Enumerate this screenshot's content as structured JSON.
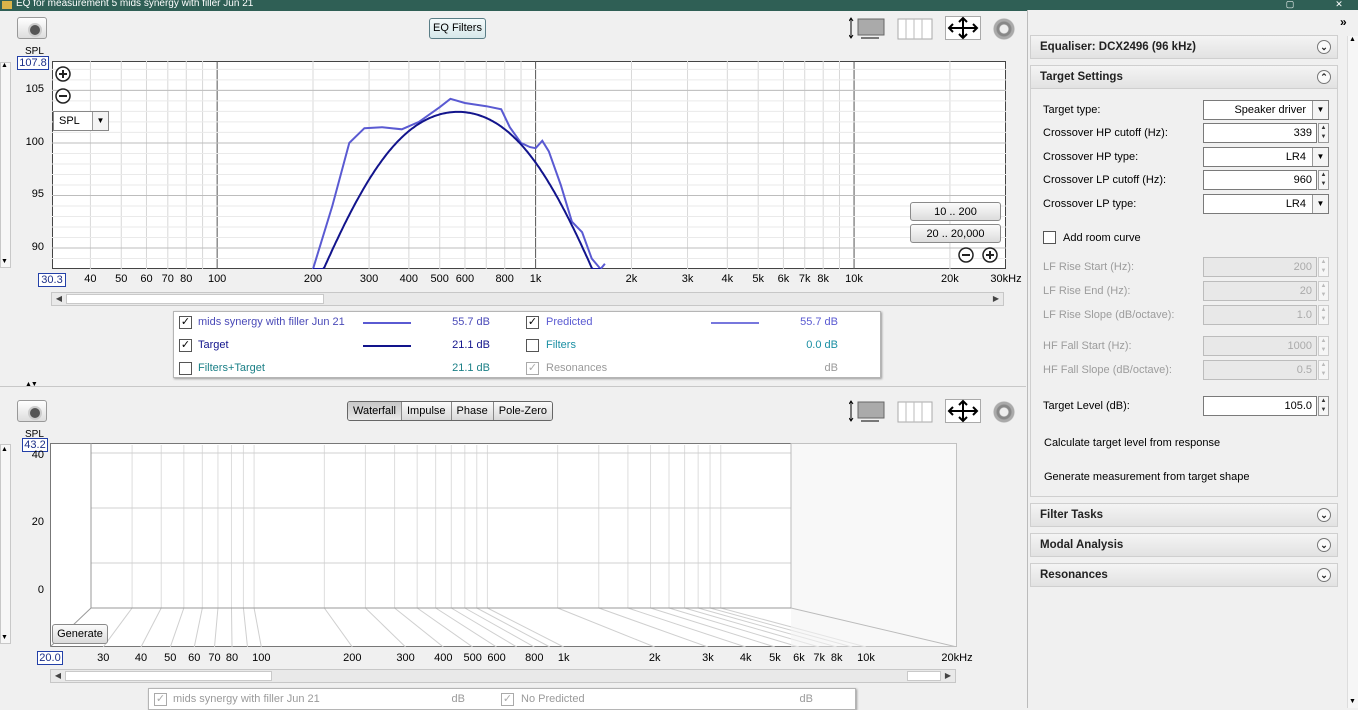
{
  "window": {
    "title": "EQ for measurement 5 mids synergy with filler Jun 21"
  },
  "top_panel": {
    "eq_filters_button": "EQ Filters",
    "y_axis_title": "SPL",
    "y_top_value": "107.8",
    "x_left_value": "30.3",
    "y_ticks": [
      "105",
      "100",
      "95",
      "90"
    ],
    "x_ticks": [
      "40",
      "50",
      "60",
      "70",
      "80",
      "100",
      "200",
      "300",
      "400",
      "500",
      "600",
      "800",
      "1k",
      "2k",
      "3k",
      "4k",
      "5k",
      "6k",
      "7k",
      "8k",
      "10k",
      "20k",
      "30kHz"
    ],
    "spl_select": "SPL",
    "range_buttons": [
      "10 .. 200",
      "20 .. 20,000"
    ],
    "legend": [
      {
        "label": "mids synergy with filler Jun 21",
        "value": "55.7 dB",
        "checked": true
      },
      {
        "label": "Predicted",
        "value": "55.7 dB",
        "checked": true
      },
      {
        "label": "Target",
        "value": "21.1 dB",
        "checked": true
      },
      {
        "label": "Filters",
        "value": "0.0 dB",
        "checked": false
      },
      {
        "label": "Filters+Target",
        "value": "21.1 dB",
        "checked": false
      },
      {
        "label": "Resonances",
        "value": "dB",
        "checked": true
      }
    ],
    "colors": {
      "measurement": "#5a5ad2",
      "target": "#12148c",
      "filters": "#1a8fa3",
      "grid": "#d8d8d8"
    }
  },
  "bottom_panel": {
    "tabs": [
      "Waterfall",
      "Impulse",
      "Phase",
      "Pole-Zero"
    ],
    "active_tab": "Waterfall",
    "y_axis_title": "SPL",
    "y_top_value": "43.2",
    "x_left_value": "20.0",
    "y_ticks": [
      "40",
      "20",
      "0"
    ],
    "x_ticks": [
      "30",
      "40",
      "50",
      "60",
      "70",
      "80",
      "100",
      "200",
      "300",
      "400",
      "500",
      "600",
      "800",
      "1k",
      "2k",
      "3k",
      "4k",
      "5k",
      "6k",
      "7k",
      "8k",
      "10k",
      "20kHz"
    ],
    "generate_button": "Generate",
    "legend": [
      {
        "label": "mids synergy with filler Jun 21",
        "value": "dB"
      },
      {
        "label": "No Predicted",
        "value": "dB"
      }
    ]
  },
  "right_panel": {
    "equaliser_header": "Equaliser: DCX2496 (96 kHz)",
    "target_settings_header": "Target Settings",
    "fields": [
      {
        "label": "Target type:",
        "value": "Speaker driver",
        "kind": "combo",
        "enabled": true
      },
      {
        "label": "Crossover HP cutoff (Hz):",
        "value": "339",
        "kind": "spin",
        "enabled": true
      },
      {
        "label": "Crossover HP type:",
        "value": "LR4",
        "kind": "combo",
        "enabled": true
      },
      {
        "label": "Crossover LP cutoff (Hz):",
        "value": "960",
        "kind": "spin",
        "enabled": true
      },
      {
        "label": "Crossover LP type:",
        "value": "LR4",
        "kind": "combo",
        "enabled": true
      }
    ],
    "add_room_curve": "Add room curve",
    "room_fields": [
      {
        "label": "LF Rise Start (Hz):",
        "value": "200"
      },
      {
        "label": "LF Rise End (Hz):",
        "value": "20"
      },
      {
        "label": "LF Rise Slope (dB/octave):",
        "value": "1.0"
      },
      {
        "label": "HF Fall Start (Hz):",
        "value": "1000"
      },
      {
        "label": "HF Fall Slope (dB/octave):",
        "value": "0.5"
      }
    ],
    "target_level_label": "Target Level (dB):",
    "target_level_value": "105.0",
    "calc_target_level": "Calculate target level from response",
    "generate_measurement": "Generate measurement from target shape",
    "collapsed_sections": [
      "Filter Tasks",
      "Modal Analysis",
      "Resonances"
    ]
  }
}
